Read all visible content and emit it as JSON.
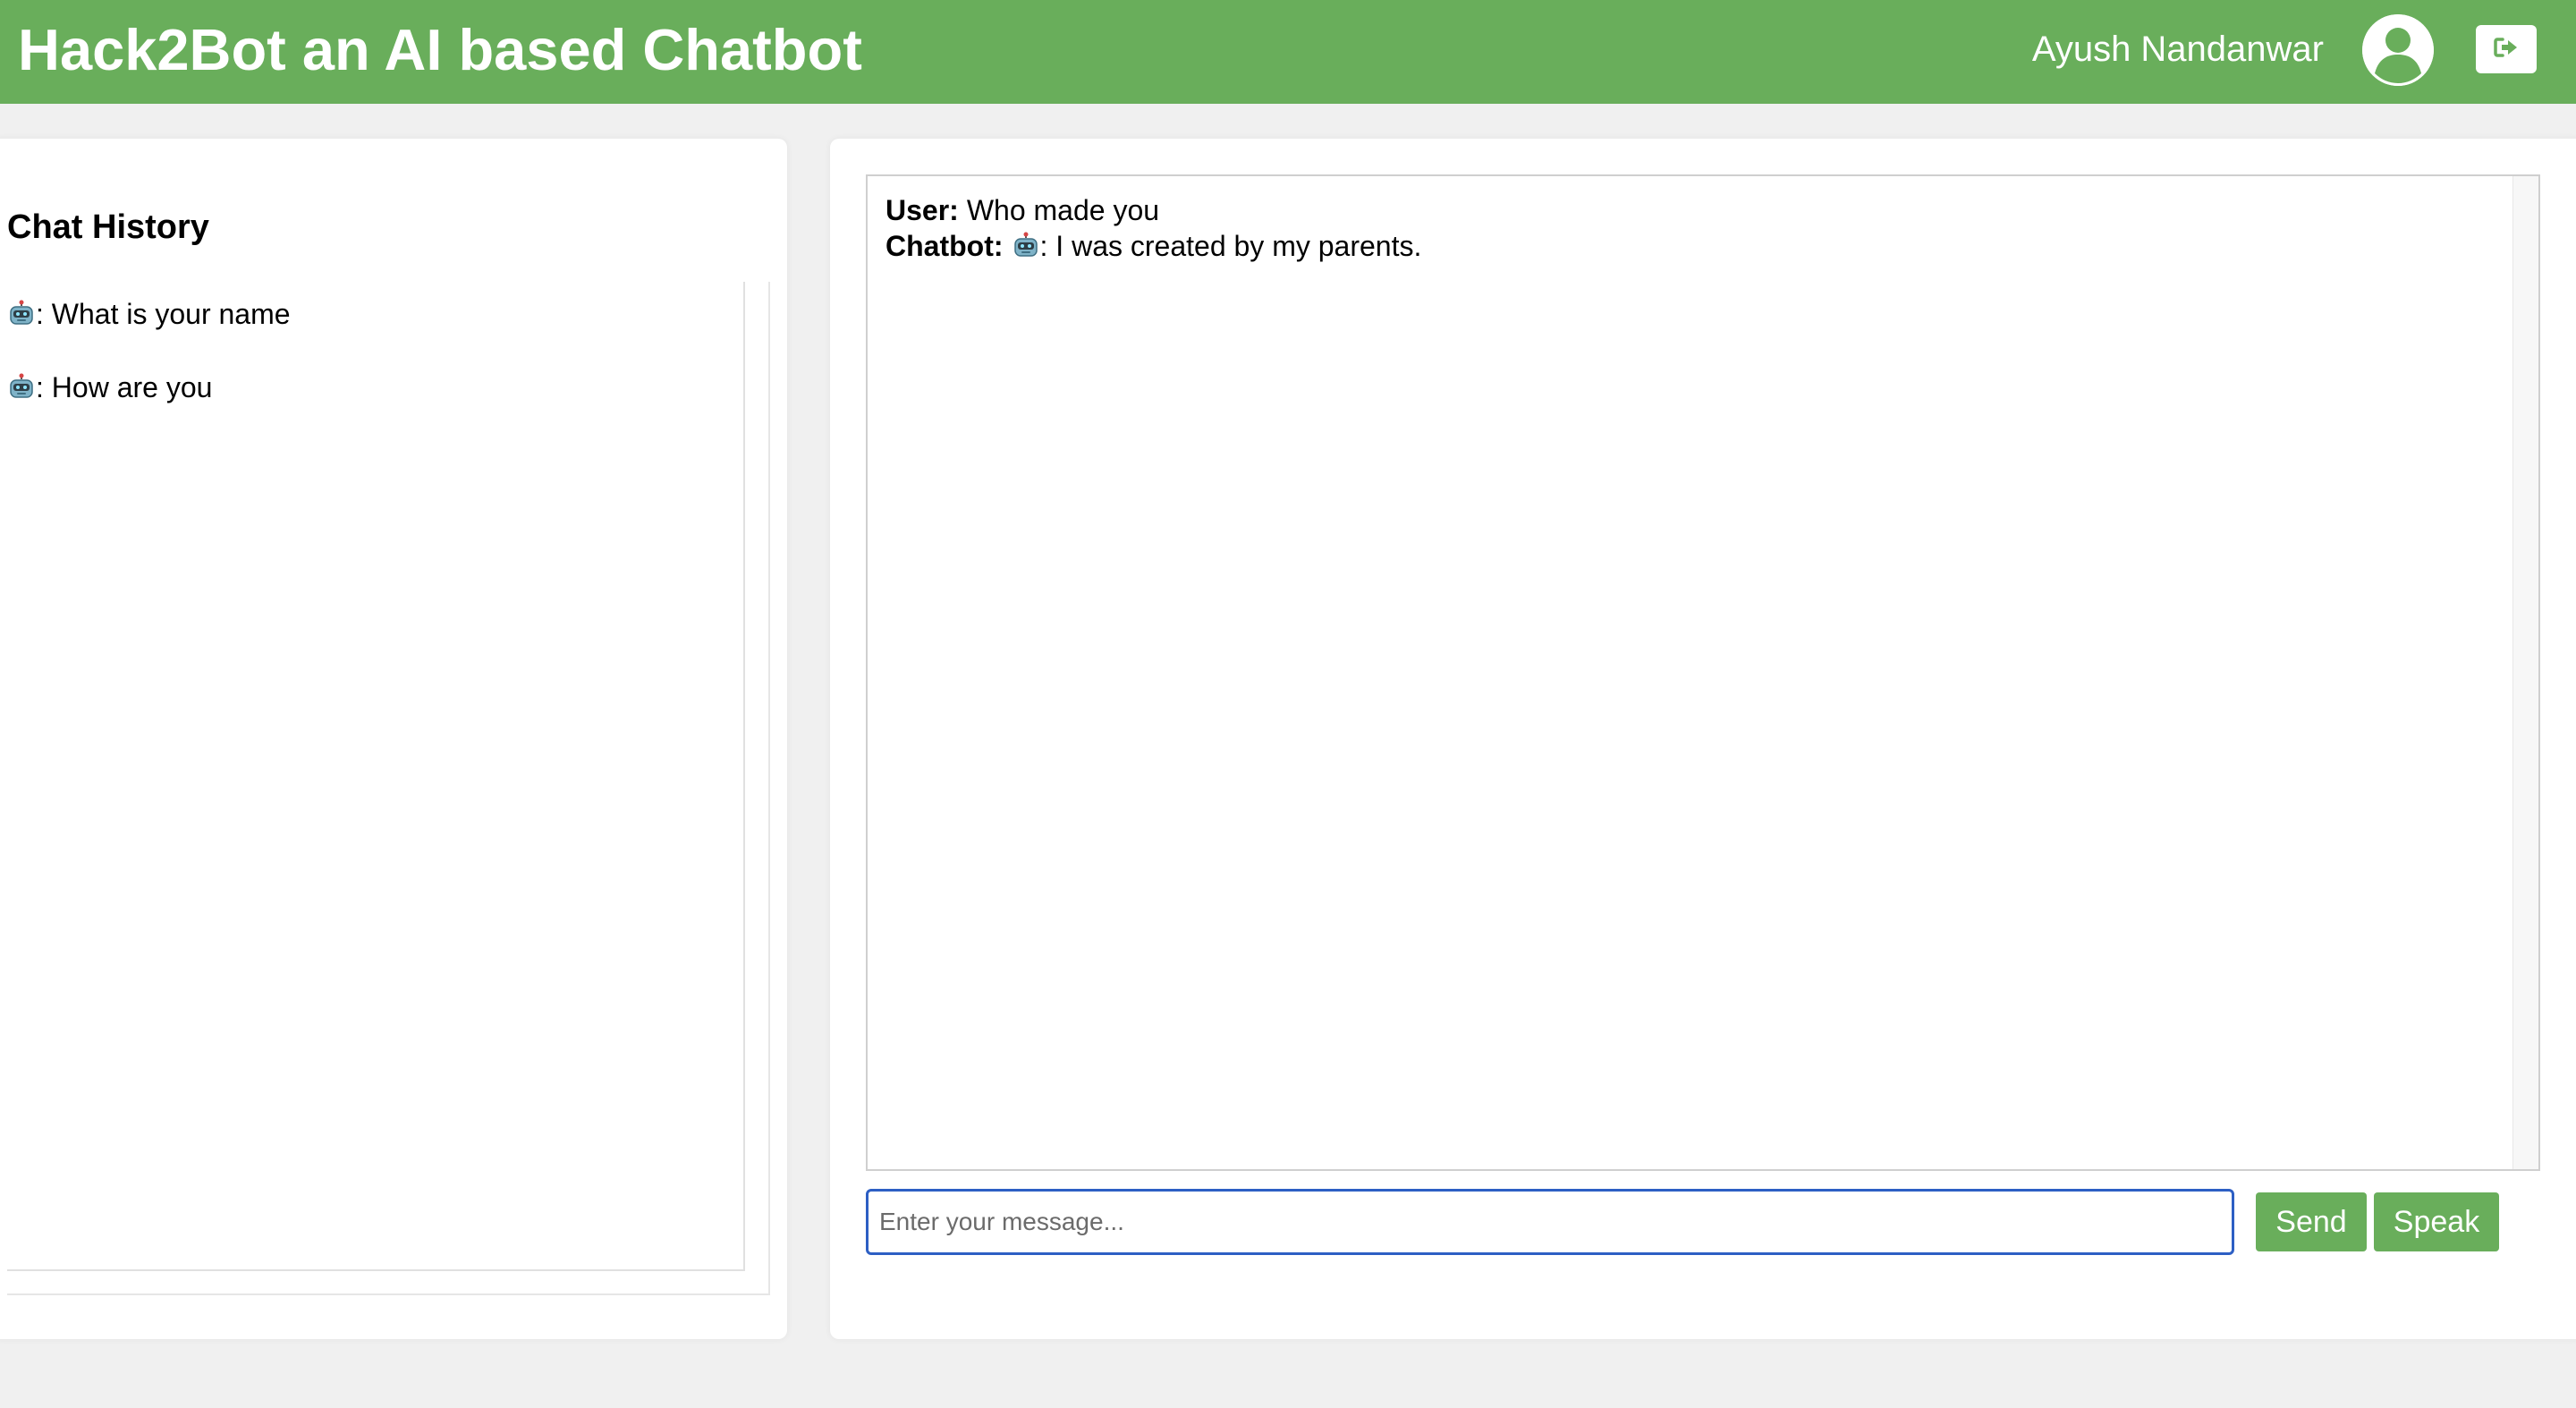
{
  "header": {
    "title": "Hack2Bot an AI based Chatbot",
    "user_name": "Ayush Nandanwar",
    "avatar_icon": "user-circle-icon",
    "logout_icon": "sign-out-icon"
  },
  "history": {
    "title": "Chat History",
    "items": [
      {
        "icon": "robot-icon",
        "separator": ":",
        "text": " What is your name"
      },
      {
        "icon": "robot-icon",
        "separator": ":",
        "text": " How are you"
      }
    ]
  },
  "chat": {
    "messages": [
      {
        "speaker": "User:",
        "text": "Who made you",
        "icon": ""
      },
      {
        "speaker": "Chatbot:",
        "icon": "robot-icon",
        "text": ": I was created by my parents."
      }
    ],
    "input": {
      "placeholder": "Enter your message...",
      "value": ""
    },
    "send_label": "Send",
    "speak_label": "Speak"
  },
  "colors": {
    "brand_green": "#69ae5b",
    "background": "#f0f0f0",
    "input_focus_border": "#2d5fc4"
  }
}
